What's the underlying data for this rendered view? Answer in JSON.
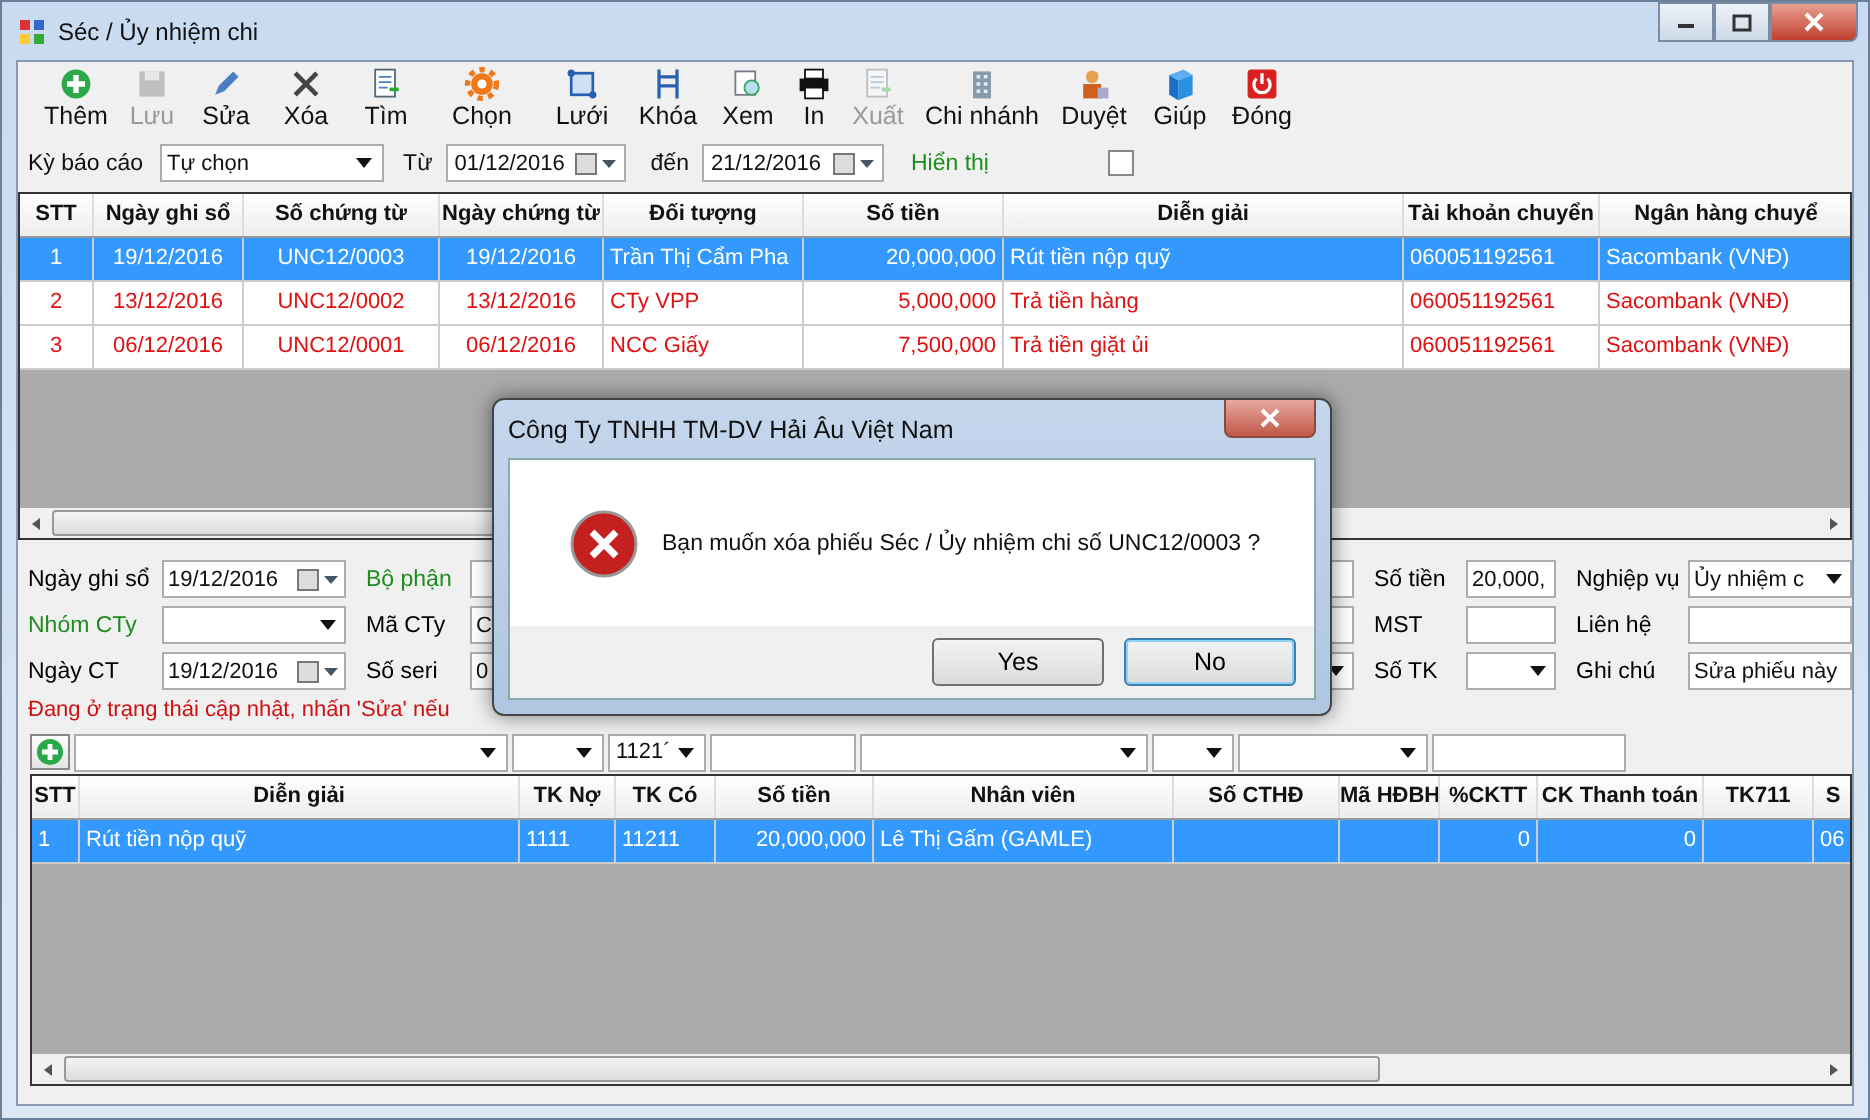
{
  "window": {
    "title": "Séc / Ủy nhiệm chi"
  },
  "toolbar": [
    {
      "label": "Thêm",
      "disabled": false
    },
    {
      "label": "Lưu",
      "disabled": true
    },
    {
      "label": "Sửa",
      "disabled": false
    },
    {
      "label": "Xóa",
      "disabled": false
    },
    {
      "label": "Tìm",
      "disabled": false
    },
    {
      "label": "Chọn",
      "disabled": false
    },
    {
      "label": "Lưới",
      "disabled": false
    },
    {
      "label": "Khóa",
      "disabled": false
    },
    {
      "label": "Xem",
      "disabled": false
    },
    {
      "label": "In",
      "disabled": false
    },
    {
      "label": "Xuất",
      "disabled": true
    },
    {
      "label": "Chi nhánh",
      "disabled": false
    },
    {
      "label": "Duyệt",
      "disabled": false
    },
    {
      "label": "Giúp",
      "disabled": false
    },
    {
      "label": "Đóng",
      "disabled": false
    }
  ],
  "filter": {
    "period_label": "Kỳ báo cáo",
    "period": "Tự chọn",
    "from_label": "Từ",
    "from": "01/12/2016",
    "to_label": "đến",
    "to": "21/12/2016",
    "show_label": "Hiển thị",
    "show_checked": false
  },
  "vouchers": {
    "columns": [
      "STT",
      "Ngày ghi sổ",
      "Số chứng từ",
      "Ngày chứng từ",
      "Đối tượng",
      "Số tiền",
      "Diễn giải",
      "Tài khoản chuyển",
      "Ngân hàng chuyể"
    ],
    "rows": [
      {
        "selected": true,
        "cells": [
          "1",
          "19/12/2016",
          "UNC12/0003",
          "19/12/2016",
          "Trần Thị Cẩm Pha",
          "20,000,000",
          "Rút tiền nộp quỹ",
          "060051192561",
          "Sacombank (VNĐ)"
        ]
      },
      {
        "selected": false,
        "cells": [
          "2",
          "13/12/2016",
          "UNC12/0002",
          "13/12/2016",
          "CTy VPP",
          "5,000,000",
          "Trả tiền hàng",
          "060051192561",
          "Sacombank (VNĐ)"
        ]
      },
      {
        "selected": false,
        "cells": [
          "3",
          "06/12/2016",
          "UNC12/0001",
          "06/12/2016",
          "NCC Giấy",
          "7,500,000",
          "Trả tiền giặt ủi",
          "060051192561",
          "Sacombank (VNĐ)"
        ]
      }
    ]
  },
  "form": {
    "rows": [
      [
        {
          "label": "Ngày ghi sổ",
          "color": "#000000",
          "kind": "date",
          "value": "19/12/2016"
        },
        {
          "label": "Bộ phận",
          "color": "#1e8c1e",
          "kind": "text"
        },
        {
          "label": "Số tiền",
          "color": "#000000",
          "kind": "text",
          "value": "20,000,"
        },
        {
          "label": "Nghiệp vụ",
          "color": "#000000",
          "kind": "combo",
          "value": "Ủy nhiệm c"
        }
      ],
      [
        {
          "label": "Nhóm CTy",
          "color": "#1e8c1e",
          "kind": "combo"
        },
        {
          "label": "Mã CTy",
          "color": "#000000",
          "kind": "text",
          "value": "C"
        },
        {
          "label": "MST",
          "color": "#000000",
          "kind": "text"
        },
        {
          "label": "Liên hệ",
          "color": "#000000",
          "kind": "text"
        }
      ],
      [
        {
          "label": "Ngày CT",
          "color": "#000000",
          "kind": "date",
          "value": "19/12/2016"
        },
        {
          "label": "Số seri",
          "color": "#000000",
          "kind": "combo",
          "value": "0"
        },
        {
          "label": "Số TK",
          "color": "#000000",
          "kind": "combo"
        },
        {
          "label": "Ghi chú",
          "color": "#000000",
          "kind": "text",
          "value": "Sửa phiếu này"
        }
      ]
    ],
    "status": "Đang ở trạng thái cập nhật, nhấn 'Sửa' nếu"
  },
  "detail_inputs": [
    {
      "dropdown": true
    },
    {
      "dropdown": true
    },
    {
      "dropdown": true,
      "value": "1121´"
    },
    {
      "dropdown": false
    },
    {
      "dropdown": true
    },
    {
      "dropdown": true
    },
    {
      "dropdown": true
    },
    {
      "dropdown": false
    }
  ],
  "details": {
    "columns": [
      "STT",
      "Diễn giải",
      "TK Nợ",
      "TK Có",
      "Số tiền",
      "Nhân viên",
      "Số CTHĐ",
      "Mã HĐBH",
      "%CKTT",
      "CK Thanh toán",
      "TK711",
      "S"
    ],
    "rows": [
      {
        "selected": true,
        "cells": [
          "1",
          "Rút tiền nộp quỹ",
          "1111",
          "11211",
          "20,000,000",
          "Lê Thị Gấm (GAMLE)",
          null,
          null,
          "0",
          "0",
          null,
          "06"
        ]
      }
    ]
  },
  "dialog": {
    "title": "Công Ty TNHH TM-DV Hải Âu Việt Nam",
    "message": "Bạn muốn xóa phiếu Séc / Ủy nhiệm chi số UNC12/0003 ?",
    "buttons": [
      {
        "label": "Yes",
        "focused": false
      },
      {
        "label": "No",
        "focused": true
      }
    ]
  }
}
